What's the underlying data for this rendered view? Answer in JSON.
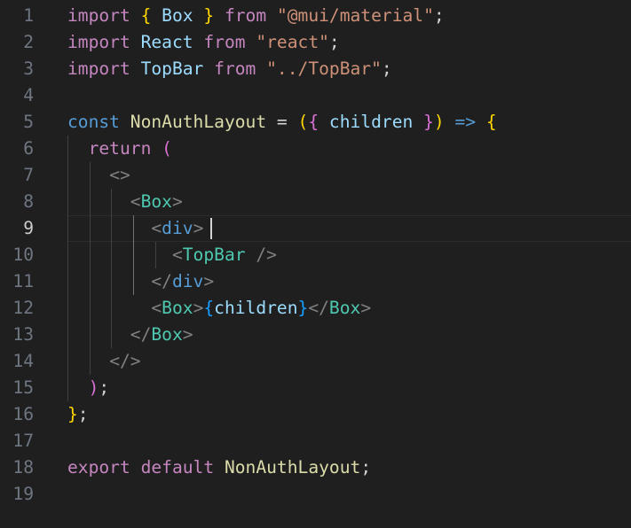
{
  "colors": {
    "background": "#1f1f1f",
    "line_number": "#6e7681",
    "line_number_active": "#cccccc",
    "keyword_control": "#c586c0",
    "keyword_storage": "#569cd6",
    "identifier": "#9cdcfe",
    "function_name": "#dcdcaa",
    "string": "#ce9178",
    "jsx_tag": "#4ec9b0",
    "jsx_bracket": "#808080",
    "punctuation": "#d4d4d4",
    "bracket_gold": "#ffd700",
    "bracket_pink": "#da70d6",
    "bracket_blue": "#179fff"
  },
  "editor": {
    "active_line_number": "9",
    "lines": [
      {
        "number": "1",
        "tokens": [
          {
            "text": "import",
            "color": "#c586c0"
          },
          {
            "text": " ",
            "color": "#d4d4d4"
          },
          {
            "text": "{",
            "color": "#ffd700"
          },
          {
            "text": " ",
            "color": "#d4d4d4"
          },
          {
            "text": "Box",
            "color": "#9cdcfe"
          },
          {
            "text": " ",
            "color": "#d4d4d4"
          },
          {
            "text": "}",
            "color": "#ffd700"
          },
          {
            "text": " ",
            "color": "#d4d4d4"
          },
          {
            "text": "from",
            "color": "#c586c0"
          },
          {
            "text": " ",
            "color": "#d4d4d4"
          },
          {
            "text": "\"@mui/material\"",
            "color": "#ce9178"
          },
          {
            "text": ";",
            "color": "#d4d4d4"
          }
        ]
      },
      {
        "number": "2",
        "tokens": [
          {
            "text": "import",
            "color": "#c586c0"
          },
          {
            "text": " ",
            "color": "#d4d4d4"
          },
          {
            "text": "React",
            "color": "#9cdcfe"
          },
          {
            "text": " ",
            "color": "#d4d4d4"
          },
          {
            "text": "from",
            "color": "#c586c0"
          },
          {
            "text": " ",
            "color": "#d4d4d4"
          },
          {
            "text": "\"react\"",
            "color": "#ce9178"
          },
          {
            "text": ";",
            "color": "#d4d4d4"
          }
        ]
      },
      {
        "number": "3",
        "tokens": [
          {
            "text": "import",
            "color": "#c586c0"
          },
          {
            "text": " ",
            "color": "#d4d4d4"
          },
          {
            "text": "TopBar",
            "color": "#9cdcfe"
          },
          {
            "text": " ",
            "color": "#d4d4d4"
          },
          {
            "text": "from",
            "color": "#c586c0"
          },
          {
            "text": " ",
            "color": "#d4d4d4"
          },
          {
            "text": "\"../TopBar\"",
            "color": "#ce9178"
          },
          {
            "text": ";",
            "color": "#d4d4d4"
          }
        ]
      },
      {
        "number": "4",
        "tokens": []
      },
      {
        "number": "5",
        "tokens": [
          {
            "text": "const",
            "color": "#569cd6"
          },
          {
            "text": " ",
            "color": "#d4d4d4"
          },
          {
            "text": "NonAuthLayout",
            "color": "#dcdcaa"
          },
          {
            "text": " = ",
            "color": "#d4d4d4"
          },
          {
            "text": "(",
            "color": "#ffd700"
          },
          {
            "text": "{",
            "color": "#da70d6"
          },
          {
            "text": " ",
            "color": "#d4d4d4"
          },
          {
            "text": "children",
            "color": "#9cdcfe"
          },
          {
            "text": " ",
            "color": "#d4d4d4"
          },
          {
            "text": "}",
            "color": "#da70d6"
          },
          {
            "text": ")",
            "color": "#ffd700"
          },
          {
            "text": " ",
            "color": "#d4d4d4"
          },
          {
            "text": "=>",
            "color": "#569cd6"
          },
          {
            "text": " ",
            "color": "#d4d4d4"
          },
          {
            "text": "{",
            "color": "#ffd700"
          }
        ]
      },
      {
        "number": "6",
        "tokens": [
          {
            "text": "  ",
            "color": "#d4d4d4"
          },
          {
            "text": "return",
            "color": "#c586c0"
          },
          {
            "text": " ",
            "color": "#d4d4d4"
          },
          {
            "text": "(",
            "color": "#da70d6"
          }
        ]
      },
      {
        "number": "7",
        "tokens": [
          {
            "text": "    ",
            "color": "#d4d4d4"
          },
          {
            "text": "<>",
            "color": "#808080"
          }
        ]
      },
      {
        "number": "8",
        "tokens": [
          {
            "text": "      ",
            "color": "#d4d4d4"
          },
          {
            "text": "<",
            "color": "#808080"
          },
          {
            "text": "Box",
            "color": "#4ec9b0"
          },
          {
            "text": ">",
            "color": "#808080"
          }
        ]
      },
      {
        "number": "9",
        "tokens": [
          {
            "text": "        ",
            "color": "#d4d4d4"
          },
          {
            "text": "<",
            "color": "#808080"
          },
          {
            "text": "div",
            "color": "#569cd6"
          },
          {
            "text": ">",
            "color": "#808080"
          }
        ]
      },
      {
        "number": "10",
        "tokens": [
          {
            "text": "          ",
            "color": "#d4d4d4"
          },
          {
            "text": "<",
            "color": "#808080"
          },
          {
            "text": "TopBar",
            "color": "#4ec9b0"
          },
          {
            "text": " ",
            "color": "#d4d4d4"
          },
          {
            "text": "/>",
            "color": "#808080"
          }
        ]
      },
      {
        "number": "11",
        "tokens": [
          {
            "text": "        ",
            "color": "#d4d4d4"
          },
          {
            "text": "</",
            "color": "#808080"
          },
          {
            "text": "div",
            "color": "#569cd6"
          },
          {
            "text": ">",
            "color": "#808080"
          }
        ]
      },
      {
        "number": "12",
        "tokens": [
          {
            "text": "        ",
            "color": "#d4d4d4"
          },
          {
            "text": "<",
            "color": "#808080"
          },
          {
            "text": "Box",
            "color": "#4ec9b0"
          },
          {
            "text": ">",
            "color": "#808080"
          },
          {
            "text": "{",
            "color": "#179fff"
          },
          {
            "text": "children",
            "color": "#9cdcfe"
          },
          {
            "text": "}",
            "color": "#179fff"
          },
          {
            "text": "</",
            "color": "#808080"
          },
          {
            "text": "Box",
            "color": "#4ec9b0"
          },
          {
            "text": ">",
            "color": "#808080"
          }
        ]
      },
      {
        "number": "13",
        "tokens": [
          {
            "text": "      ",
            "color": "#d4d4d4"
          },
          {
            "text": "</",
            "color": "#808080"
          },
          {
            "text": "Box",
            "color": "#4ec9b0"
          },
          {
            "text": ">",
            "color": "#808080"
          }
        ]
      },
      {
        "number": "14",
        "tokens": [
          {
            "text": "    ",
            "color": "#d4d4d4"
          },
          {
            "text": "</>",
            "color": "#808080"
          }
        ]
      },
      {
        "number": "15",
        "tokens": [
          {
            "text": "  ",
            "color": "#d4d4d4"
          },
          {
            "text": ")",
            "color": "#da70d6"
          },
          {
            "text": ";",
            "color": "#d4d4d4"
          }
        ]
      },
      {
        "number": "16",
        "tokens": [
          {
            "text": "}",
            "color": "#ffd700"
          },
          {
            "text": ";",
            "color": "#d4d4d4"
          }
        ]
      },
      {
        "number": "17",
        "tokens": []
      },
      {
        "number": "18",
        "tokens": [
          {
            "text": "export",
            "color": "#c586c0"
          },
          {
            "text": " ",
            "color": "#d4d4d4"
          },
          {
            "text": "default",
            "color": "#c586c0"
          },
          {
            "text": " ",
            "color": "#d4d4d4"
          },
          {
            "text": "NonAuthLayout",
            "color": "#dcdcaa"
          },
          {
            "text": ";",
            "color": "#d4d4d4"
          }
        ]
      },
      {
        "number": "19",
        "tokens": []
      }
    ]
  }
}
